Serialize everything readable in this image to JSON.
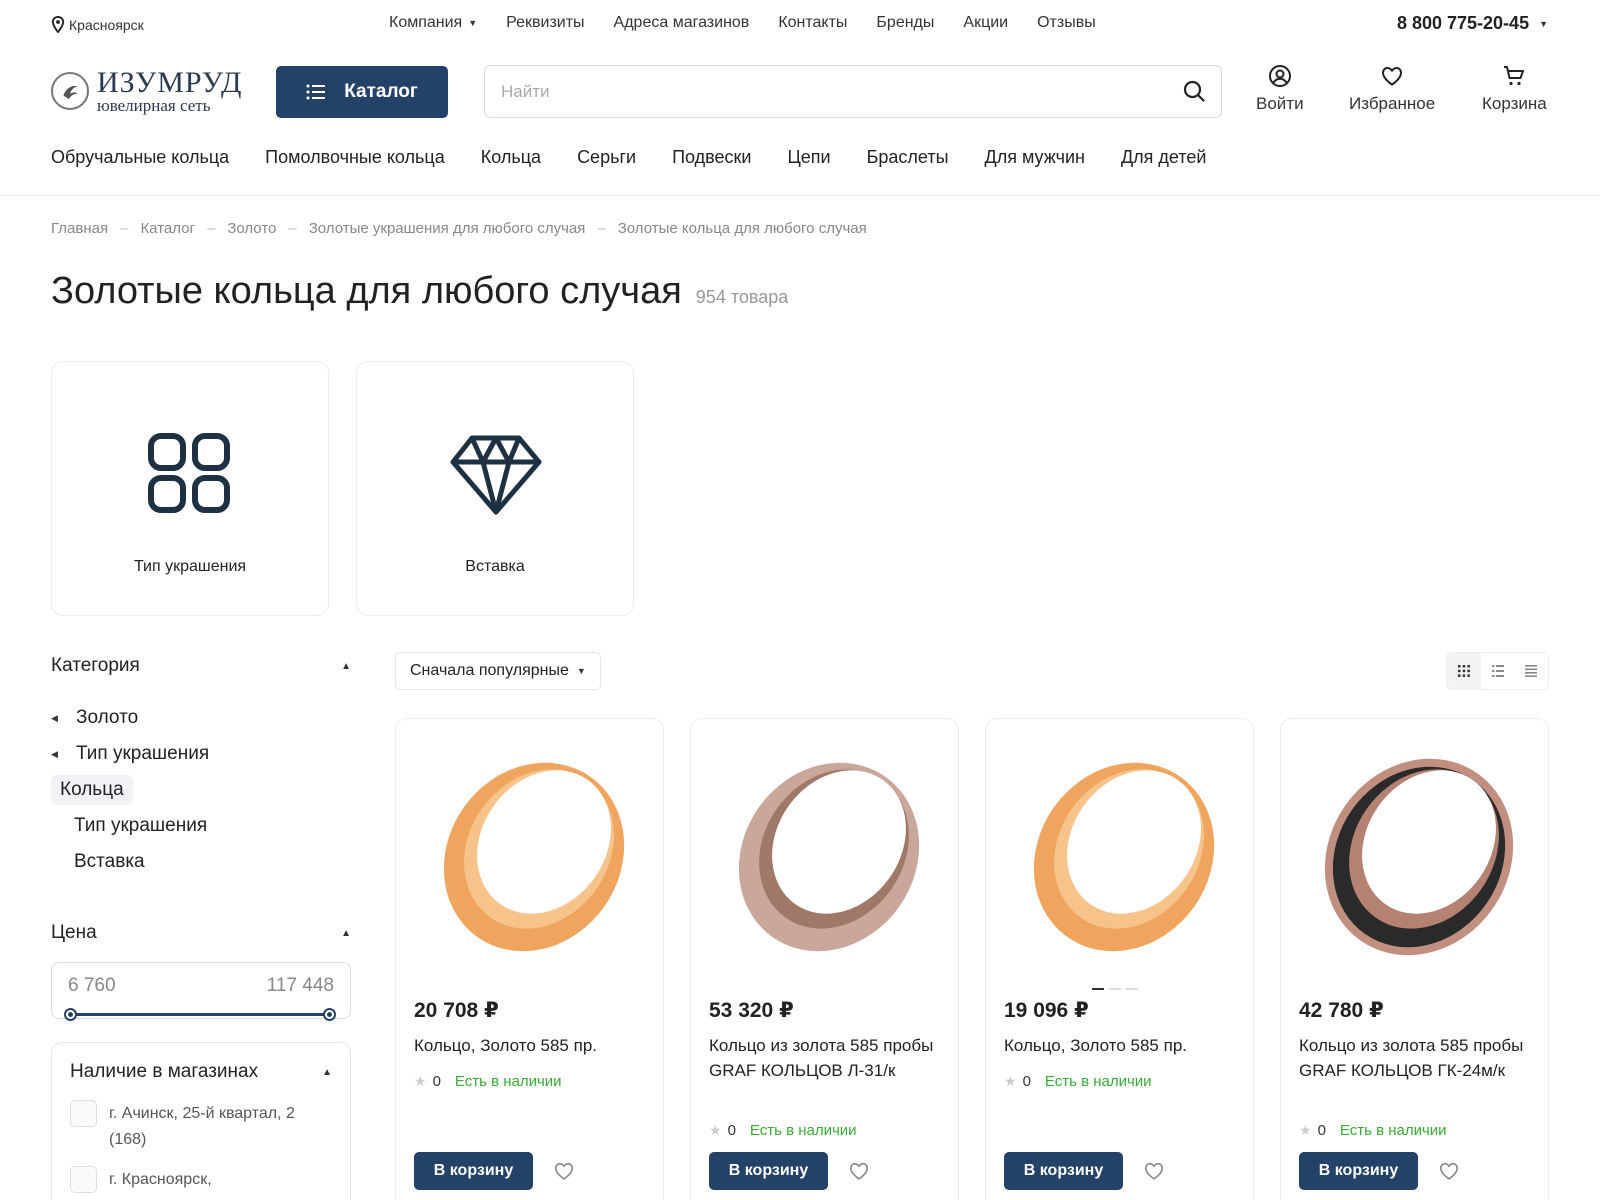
{
  "topbar": {
    "city": "Красноярск",
    "nav": [
      "Компания",
      "Реквизиты",
      "Адреса магазинов",
      "Контакты",
      "Бренды",
      "Акции",
      "Отзывы"
    ],
    "phone": "8 800 775-20-45"
  },
  "header": {
    "logo_title": "ИЗУМРУД",
    "logo_sub": "ювелирная сеть",
    "catalog_label": "Каталог",
    "search_placeholder": "Найти",
    "login_label": "Войти",
    "favorites_label": "Избранное",
    "cart_label": "Корзина"
  },
  "catnav": [
    "Обручальные кольца",
    "Помолвочные кольца",
    "Кольца",
    "Серьги",
    "Подвески",
    "Цепи",
    "Браслеты",
    "Для мужчин",
    "Для детей"
  ],
  "breadcrumb": [
    "Главная",
    "Каталог",
    "Золото",
    "Золотые украшения для любого случая",
    "Золотые кольца для любого случая"
  ],
  "page": {
    "title": "Золотые кольца для любого случая",
    "count": "954 товара"
  },
  "tiles": [
    "Тип украшения",
    "Вставка"
  ],
  "sidebar": {
    "category_title": "Категория",
    "categories": [
      "Золото",
      "Тип украшения",
      "Кольца",
      "Тип украшения",
      "Вставка"
    ],
    "price_title": "Цена",
    "price_min": "6 760",
    "price_max": "117 448",
    "stock_title": "Наличие в магазинах",
    "stores": [
      "г. Ачинск, 25-й квартал, 2 (168)",
      "г. Красноярск,"
    ]
  },
  "sort": {
    "label": "Сначала популярные"
  },
  "products": [
    {
      "price": "20 708 ₽",
      "name": "Кольцо, Золото 585 пр.",
      "rating": "0",
      "stock": "Есть в наличии",
      "cart": "В корзину",
      "metal": "gold"
    },
    {
      "price": "53 320 ₽",
      "name": "Кольцо из золота 585 пробы GRAF КОЛЬЦОВ Л-31/к",
      "rating": "0",
      "stock": "Есть в наличии",
      "cart": "В корзину",
      "metal": "rose"
    },
    {
      "price": "19 096 ₽",
      "name": "Кольцо, Золото 585 пр.",
      "rating": "0",
      "stock": "Есть в наличии",
      "cart": "В корзину",
      "metal": "gold"
    },
    {
      "price": "42 780 ₽",
      "name": "Кольцо из золота 585 пробы GRAF КОЛЬЦОВ ГК-24м/к",
      "rating": "0",
      "stock": "Есть в наличии",
      "cart": "В корзину",
      "metal": "black"
    }
  ],
  "colors": {
    "primary": "#244268",
    "instock": "#3aa935"
  }
}
